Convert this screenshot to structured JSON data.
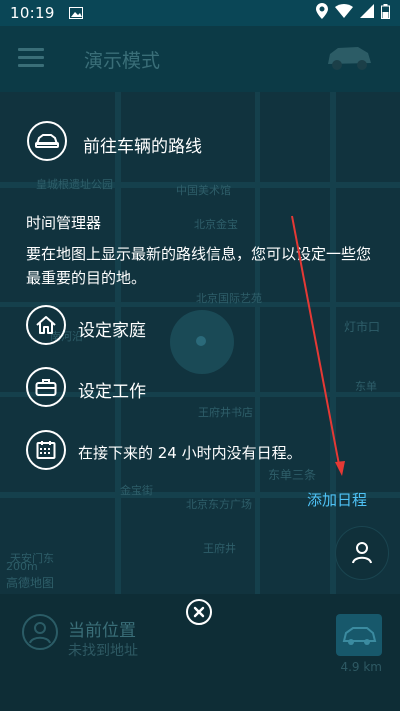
{
  "status_bar": {
    "time": "10:19"
  },
  "app_bar": {
    "title": "演示模式"
  },
  "map": {
    "labels": [
      "皇城根遗址公园",
      "中国美术馆",
      "北京金宝",
      "北京国际艺苑",
      "东方广场",
      "灯市口",
      "天安门东",
      "王府井",
      "东单三条",
      "北京东方广场",
      "金宝街",
      "王府井书店",
      "南河沿",
      "东单"
    ],
    "scale": "200m",
    "brand": "高德地图"
  },
  "overlay": {
    "route_label": "前往车辆的路线",
    "time_manager_title": "时间管理器",
    "time_manager_desc": "要在地图上显示最新的路线信息，您可以设定一些您最重要的目的地。",
    "home_label": "设定家庭",
    "work_label": "设定工作",
    "calendar_label": "在接下来的 24 小时内没有日程。",
    "add_schedule": "添加日程"
  },
  "bottom_panel": {
    "title": "当前位置",
    "subtitle": "未找到地址",
    "distance": "4.9 km"
  },
  "colors": {
    "accent": "#4fc3f7",
    "arrow": "#e53935",
    "overlay_text": "#ffffff"
  }
}
